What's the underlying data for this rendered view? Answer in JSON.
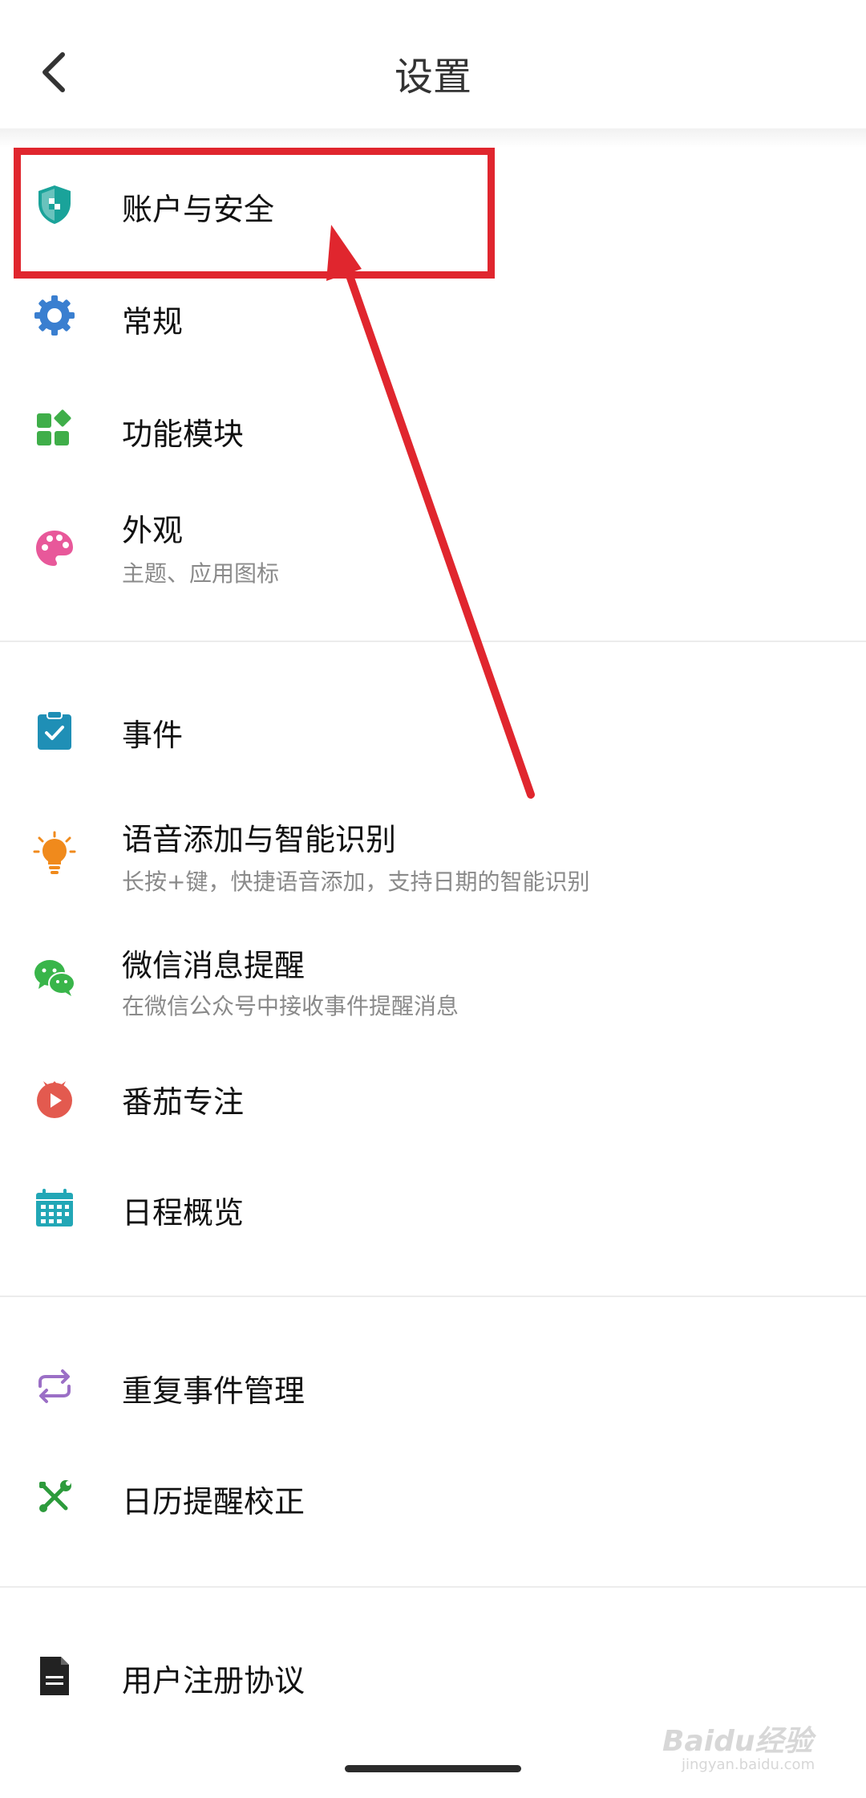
{
  "header": {
    "title": "设置"
  },
  "settings": {
    "account_security": {
      "label": "账户与安全",
      "icon": "shield-icon"
    },
    "general": {
      "label": "常规",
      "icon": "gear-icon"
    },
    "modules": {
      "label": "功能模块",
      "icon": "modules-icon"
    },
    "appearance": {
      "label": "外观",
      "sub": "主题、应用图标",
      "icon": "palette-icon"
    },
    "events": {
      "label": "事件",
      "icon": "clipboard-check-icon"
    },
    "voice": {
      "label": "语音添加与智能识别",
      "sub": "长按+键，快捷语音添加，支持日期的智能识别",
      "icon": "lightbulb-icon"
    },
    "wechat": {
      "label": "微信消息提醒",
      "sub": "在微信公众号中接收事件提醒消息",
      "icon": "wechat-icon"
    },
    "pomodoro": {
      "label": "番茄专注",
      "icon": "tomato-timer-icon"
    },
    "schedule": {
      "label": "日程概览",
      "icon": "calendar-icon"
    },
    "repeat": {
      "label": "重复事件管理",
      "icon": "repeat-icon"
    },
    "calibration": {
      "label": "日历提醒校正",
      "icon": "tools-icon"
    },
    "agreement": {
      "label": "用户注册协议",
      "icon": "document-icon"
    }
  },
  "annotation": {
    "color": "#e0262e"
  },
  "watermark": {
    "text": "Baidu经验",
    "sub": "jingyan.baidu.com"
  },
  "colors": {
    "shield": "#1aa39a",
    "gear": "#3a7fd0",
    "modules": "#3fae49",
    "palette": "#e8589a",
    "events": "#1f8fb6",
    "bulb": "#f08a1c",
    "wechat": "#39b54a",
    "tomato": "#e35a4f",
    "calendar": "#22a7b6",
    "repeat": "#9b6fc6",
    "tools": "#2d9b3c",
    "document": "#222222"
  }
}
